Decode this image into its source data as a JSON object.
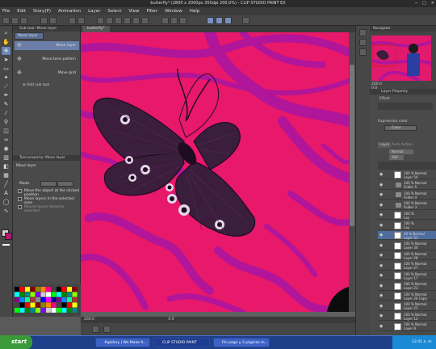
{
  "window": {
    "title": "butterfly* (2800 x 2000px 350dpi 200.0%) - CLIP STUDIO PAINT EX",
    "controls": [
      "─",
      "□",
      "✕"
    ]
  },
  "menu": [
    "File",
    "Edit",
    "Story(P)",
    "Animation",
    "Layer",
    "Select",
    "View",
    "Filter",
    "Window",
    "Help"
  ],
  "subtool": {
    "header": "Sub tool: Move layer",
    "tabs": [
      "Move layer"
    ],
    "items": [
      "Move layer",
      "Move tone pattern",
      "Move grid"
    ],
    "add": "Add sub tool"
  },
  "toolprop": {
    "header": "Tool property: Move layer",
    "title": "Move layer",
    "mode_label": "Mode",
    "options": [
      "Move the object at the clicked position",
      "Move layers in the selected area",
      "Moved layers become selected"
    ]
  },
  "canvas": {
    "tab": "butterfly*",
    "zoom": "200.0",
    "status_extra": "0.0"
  },
  "navigator": {
    "header": "Navigator",
    "zoom": "200.0",
    "angle": "0.0"
  },
  "layerprop": {
    "header": "Layer Property",
    "effect": "Effect",
    "expression_label": "Expression color",
    "expression_value": "Color"
  },
  "layers": {
    "tabs": [
      "Layer",
      "Auto Action"
    ],
    "blend": "Normal",
    "opacity": "100",
    "rows": [
      {
        "l1": "100 % Normal",
        "l2": "Layer 54"
      },
      {
        "l1": "100 % Normal",
        "l2": "Folder 5"
      },
      {
        "l1": "100 % Normal",
        "l2": "Folder 4"
      },
      {
        "l1": "100 % Normal",
        "l2": "Folder 3"
      },
      {
        "l1": "100 %",
        "l2": "Lay"
      },
      {
        "l1": "100 %",
        "l2": "Lay"
      },
      {
        "l1": "20 % Normal",
        "l2": "Layer 31"
      },
      {
        "l1": "100 % Normal",
        "l2": "Layer 30"
      },
      {
        "l1": "100 % Normal",
        "l2": "Layer 28"
      },
      {
        "l1": "100 % Normal",
        "l2": "Layer 27"
      },
      {
        "l1": "100 % Normal",
        "l2": "Layer 17"
      },
      {
        "l1": "100 % Normal",
        "l2": "Layer 23"
      },
      {
        "l1": "100 % Normal",
        "l2": "Layer 26 Copy"
      },
      {
        "l1": "100 % Normal",
        "l2": "Layer 25"
      },
      {
        "l1": "100 % Normal",
        "l2": "Layer 12"
      },
      {
        "l1": "100 % Normal",
        "l2": "Layer 8"
      }
    ]
  },
  "taskbar": {
    "start": "start",
    "tasks": [
      "#gallery | We Make It...",
      "CLIP STUDIO PAINT",
      "",
      "Pin page y 3 páginas m..."
    ],
    "time": "12:41 a. m."
  },
  "colors": {
    "canvas_bg": "#e8186a",
    "swirl": "#b0159a",
    "moth": "#3a1e3c"
  }
}
